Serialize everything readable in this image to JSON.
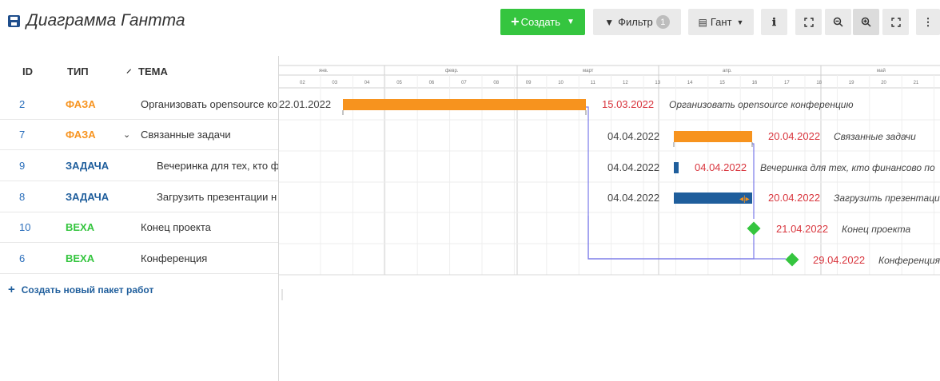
{
  "header": {
    "title": "Диаграмма Гантта",
    "create_label": "Создать",
    "filter_label": "Фильтр",
    "filter_count": "1",
    "view_label": "Гант"
  },
  "table": {
    "headers": {
      "id": "ID",
      "type": "ТИП",
      "subject": "ТЕМА"
    },
    "rows": [
      {
        "id": "2",
        "type": "ФАЗА",
        "subject": "Организовать opensource ко",
        "type_color": "#f7931e"
      },
      {
        "id": "7",
        "type": "ФАЗА",
        "subject": "Связанные задачи",
        "type_color": "#f7931e"
      },
      {
        "id": "9",
        "type": "ЗАДАЧА",
        "subject": "Вечеринка для тех, кто ф",
        "type_color": "#1f5e9c"
      },
      {
        "id": "8",
        "type": "ЗАДАЧА",
        "subject": "Загрузить презентации н",
        "type_color": "#1f5e9c"
      },
      {
        "id": "10",
        "type": "ВЕХА",
        "subject": "Конец проекта",
        "type_color": "#35c53f"
      },
      {
        "id": "6",
        "type": "ВЕХА",
        "subject": "Конференция",
        "type_color": "#35c53f"
      }
    ],
    "add_label": "Создать новый пакет работ"
  },
  "gantt": {
    "months": [
      "янв.",
      "февр.",
      "март",
      "апр.",
      "май"
    ],
    "weeks": [
      "02",
      "03",
      "04",
      "05",
      "06",
      "07",
      "08",
      "09",
      "10",
      "11",
      "12",
      "13",
      "14",
      "15",
      "16",
      "17",
      "18",
      "19",
      "20",
      "21"
    ],
    "labels": [
      {
        "start": "22.01.2022",
        "due": "15.03.2022",
        "name": "Организовать opensource конференцию"
      },
      {
        "start": "04.04.2022",
        "due": "20.04.2022",
        "name": "Связанные задачи"
      },
      {
        "start": "04.04.2022",
        "due": "04.04.2022",
        "name": "Вечеринка для тех, кто финансово по"
      },
      {
        "start": "04.04.2022",
        "due": "20.04.2022",
        "name": "Загрузить презентации"
      },
      {
        "start": "",
        "due": "21.04.2022",
        "name": "Конец проекта"
      },
      {
        "start": "",
        "due": "29.04.2022",
        "name": "Конференция"
      }
    ],
    "colors": {
      "phase": "#f7931e",
      "task": "#1f5e9c",
      "milestone": "#35c53f",
      "relation": "#7a7ae8"
    }
  }
}
